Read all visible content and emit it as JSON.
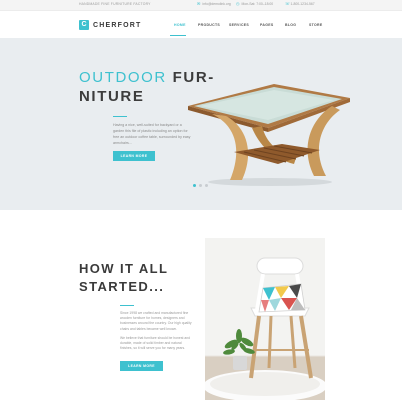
{
  "topbar": {
    "tagline": "HANDMADE FINE FURNITURE FACTORY",
    "email": "info@demolink.org",
    "hours": "Mon-Sat: 7:00–18:00",
    "phone": "1-800-1234-567"
  },
  "header": {
    "logo_letter": "C",
    "logo_text": "CHERFORT",
    "nav": [
      "HOME",
      "PRODUCTS",
      "SERVICES",
      "PAGES",
      "BLOG",
      "STORE"
    ],
    "active_nav": "HOME"
  },
  "hero": {
    "title_accent": "OUTDOOR",
    "title_line1_rest": "FUR-",
    "title_line2": "NITURE",
    "description": "Having a nice, well-suited for backyard or a garden this file of plastic including an option for free an outdoor coffee table, surrounded by easy armchairs...",
    "button_label": "LEARN MORE",
    "slides_total": 3,
    "slide_active": 1
  },
  "story": {
    "title_line1": "HOW IT ALL",
    "title_line2": "STARTED...",
    "paragraph1": "Since 1998 we crafted and manufactured fine wooden furniture for homes, designers and businesses around the country. Our high quality chairs and tables became well known.",
    "paragraph2": "We believe that furniture should be honest and durable, made of solid timber and natural finishes, so it will serve you for many years.",
    "button_label": "LEARN MORE"
  },
  "colors": {
    "accent": "#3ec1cf",
    "hero_bg": "#e9edf0",
    "text_dark": "#3a3a3a"
  }
}
